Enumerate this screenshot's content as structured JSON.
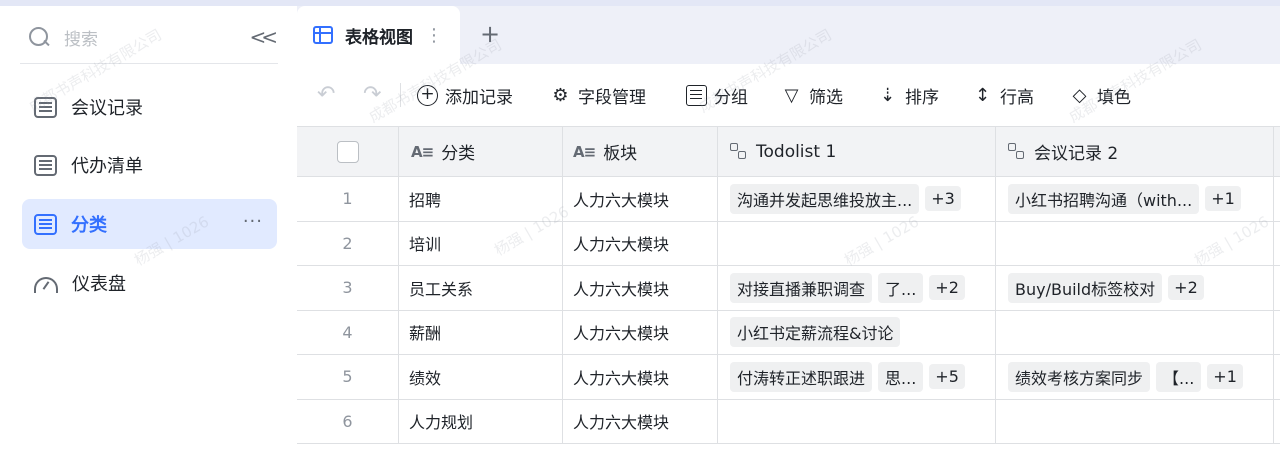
{
  "sidebar": {
    "search_placeholder": "搜索",
    "items": [
      {
        "label": "会议记录"
      },
      {
        "label": "代办清单"
      },
      {
        "label": "分类"
      },
      {
        "label": "仪表盘"
      }
    ],
    "more_label": "···"
  },
  "tabs": [
    {
      "label": "表格视图",
      "menu": "⋮"
    }
  ],
  "add_tab": "+",
  "toolbar": {
    "add_record": "添加记录",
    "field_manage": "字段管理",
    "group": "分组",
    "filter": "筛选",
    "sort": "排序",
    "row_height": "行高",
    "fill_color": "填色"
  },
  "table": {
    "columns": [
      "分类",
      "板块",
      "Todolist 1",
      "会议记录 2"
    ],
    "rows": [
      {
        "num": "1",
        "category": "招聘",
        "block": "人力六大模块",
        "todo": [
          "沟通并发起思维投放主..."
        ],
        "todo_more": "+3",
        "meeting": [
          "小红书招聘沟通（with..."
        ],
        "meeting_more": "+1"
      },
      {
        "num": "2",
        "category": "培训",
        "block": "人力六大模块",
        "todo": [],
        "todo_more": "",
        "meeting": [],
        "meeting_more": ""
      },
      {
        "num": "3",
        "category": "员工关系",
        "block": "人力六大模块",
        "todo": [
          "对接直播兼职调查",
          "了..."
        ],
        "todo_more": "+2",
        "meeting": [
          "Buy/Build标签校对"
        ],
        "meeting_more": "+2"
      },
      {
        "num": "4",
        "category": "薪酬",
        "block": "人力六大模块",
        "todo": [
          "小红书定薪流程&讨论"
        ],
        "todo_more": "",
        "meeting": [],
        "meeting_more": ""
      },
      {
        "num": "5",
        "category": "绩效",
        "block": "人力六大模块",
        "todo": [
          "付涛转正述职跟进",
          "思..."
        ],
        "todo_more": "+5",
        "meeting": [
          "绩效考核方案同步",
          "【..."
        ],
        "meeting_more": "+1"
      },
      {
        "num": "6",
        "category": "人力规划",
        "block": "人力六大模块",
        "todo": [],
        "todo_more": "",
        "meeting": [],
        "meeting_more": ""
      }
    ]
  },
  "watermark": {
    "company": "成都书声科技有限公司",
    "user": "杨强 | 1026"
  }
}
